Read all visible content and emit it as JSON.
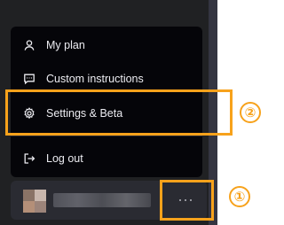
{
  "menu": {
    "items": [
      {
        "label": "My plan",
        "icon": "user-icon"
      },
      {
        "label": "Custom instructions",
        "icon": "message-dots-icon"
      },
      {
        "label": "Settings & Beta",
        "icon": "gear-icon"
      },
      {
        "label": "Log out",
        "icon": "logout-icon"
      }
    ]
  },
  "user_row": {
    "more_icon": "ellipsis-icon"
  },
  "annotations": {
    "settings_number": "②",
    "more_number": "①",
    "color": "#f7a21b"
  }
}
